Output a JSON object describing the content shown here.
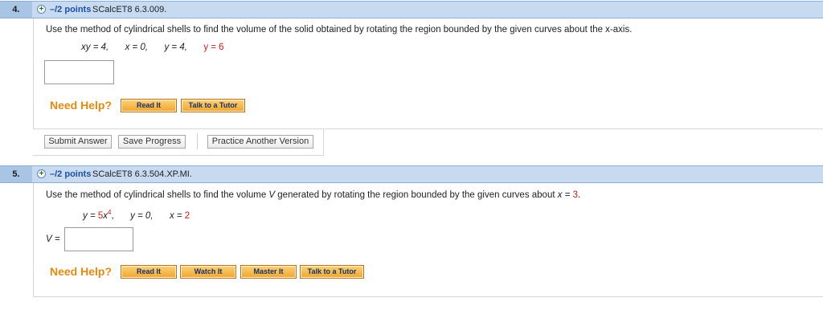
{
  "q4": {
    "number": "4.",
    "plus_symbol": "+",
    "points": "–/2 points",
    "source": "SCalcET8 6.3.009.",
    "prompt": "Use the method of cylindrical shells to find the volume of the solid obtained by rotating the region bounded by the given curves about the x-axis.",
    "equations": [
      "xy = 4,",
      "x = 0,",
      "y = 4,",
      "y = 6"
    ],
    "need_help": "Need Help?",
    "help_buttons": [
      "Read It",
      "Talk to a Tutor"
    ],
    "actions": [
      "Submit Answer",
      "Save Progress",
      "Practice Another Version"
    ]
  },
  "q5": {
    "number": "5.",
    "plus_symbol": "+",
    "points": "–/2 points",
    "source": "SCalcET8 6.3.504.XP.MI.",
    "prompt_before": "Use the method of cylindrical shells to find the volume ",
    "prompt_var": "V",
    "prompt_mid": " generated by rotating the region bounded by the given curves about ",
    "prompt_axis": "x = ",
    "prompt_axis_val": "3",
    "prompt_end": ".",
    "eq1_lhs": "y = ",
    "eq1_coef": "5",
    "eq1_x": "x",
    "eq1_exp": "4",
    "eq1_tail": ",",
    "eq2": "y = 0,",
    "eq3_lhs": "x = ",
    "eq3_val": "2",
    "answer_label": "V =",
    "need_help": "Need Help?",
    "help_buttons": [
      "Read It",
      "Watch It",
      "Master It",
      "Talk to a Tutor"
    ]
  },
  "colors": {
    "header_bg": "#a9c5e6",
    "points_blue": "#1f4fa0",
    "need_help_orange": "#e38a12",
    "highlight_red": "#c2211c"
  }
}
